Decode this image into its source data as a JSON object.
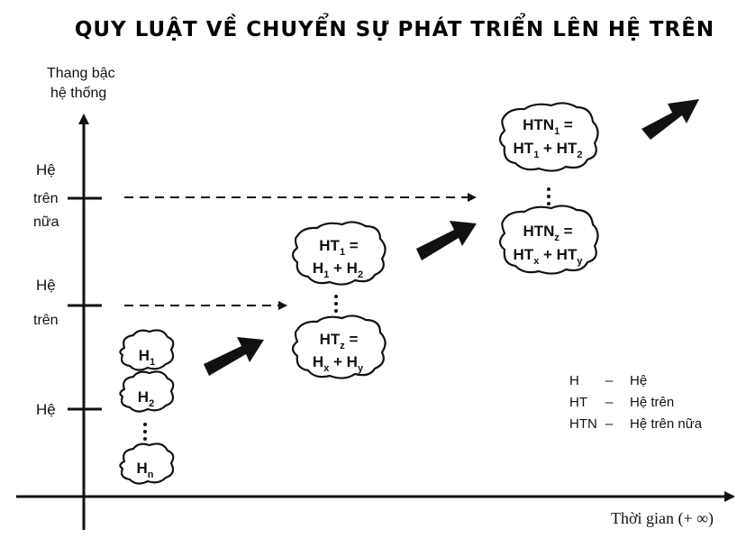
{
  "title": "QUY LUẬT VỀ CHUYỂN SỰ PHÁT TRIỂN LÊN HỆ TRÊN",
  "y_axis": {
    "line1": "Thang bậc",
    "line2": "hệ thống"
  },
  "x_axis": {
    "label": "Thời gian (+ ∞)"
  },
  "levels": {
    "he": "Hệ",
    "he_tren": {
      "line1": "Hệ",
      "line2": "trên"
    },
    "he_tren_nua": {
      "line1": "Hệ",
      "line2": "trên",
      "line3": "nữa"
    }
  },
  "level1_nodes": {
    "h1": {
      "base": "H",
      "sub": "1"
    },
    "h2": {
      "base": "H",
      "sub": "2"
    },
    "hn": {
      "base": "H",
      "sub": "n"
    }
  },
  "level2_nodes": {
    "ht1": {
      "a": "HT",
      "a_sub": "1",
      "eq": " =",
      "b": "H",
      "b_sub": "1",
      "plus": " + H",
      "c_sub": "2"
    },
    "htz": {
      "a": "HT",
      "a_sub": "z",
      "eq": " =",
      "b": "H",
      "b_sub": "x",
      "plus": " + H",
      "c_sub": "y"
    }
  },
  "level3_nodes": {
    "htn1": {
      "a": "HTN",
      "a_sub": "1",
      "eq": " =",
      "b": "HT",
      "b_sub": "1",
      "plus": " + HT",
      "c_sub": "2"
    },
    "htnz": {
      "a": "HTN",
      "a_sub": "z",
      "eq": " =",
      "b": "HT",
      "b_sub": "x",
      "plus": " + HT",
      "c_sub": "y"
    }
  },
  "legend": [
    {
      "abbr": "H",
      "dash": "–",
      "meaning": "Hệ"
    },
    {
      "abbr": "HT",
      "dash": "–",
      "meaning": "Hệ trên"
    },
    {
      "abbr": "HTN",
      "dash": "–",
      "meaning": "Hệ trên nữa"
    }
  ]
}
